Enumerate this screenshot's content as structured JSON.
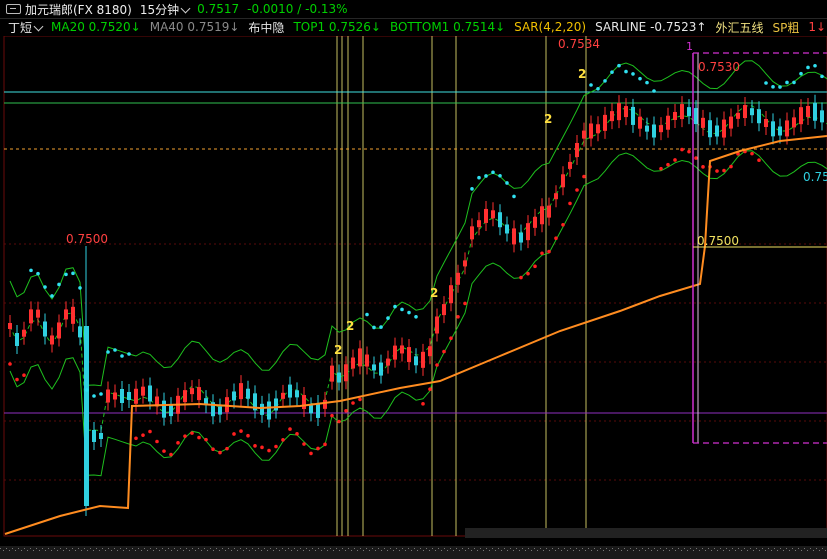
{
  "window": {
    "title": "加元瑞郎(FX 8180)",
    "period": "15分钟",
    "price": "0.7517",
    "change": "-0.0010 / -0.13%"
  },
  "indicators": {
    "style": "丁短",
    "ma20": "MA20 0.7520↓",
    "ma40": "MA40 0.7519↓",
    "layout": "布中隐",
    "top1": "TOP1 0.7526↓",
    "bottom1": "BOTTOM1 0.7514↓",
    "sar": "SAR(4,2,20)",
    "sarline": "SARLINE -0.7523↑",
    "fx_lines": "外汇五线",
    "sp": "SP粗",
    "sp_count": "1↓"
  },
  "chart": {
    "labels": {
      "high_left": "0.7500",
      "high_top": "0.7534",
      "box_top": "0.7530",
      "box_mid": "0.7500",
      "box_index": "1",
      "right_edge": "0.75",
      "marks": [
        "2",
        "2",
        "2",
        "2",
        "2"
      ]
    },
    "colors": {
      "up": "#ff3030",
      "down": "#30d0e0",
      "sar": "#ff2020",
      "sar_top": "#30e0f0",
      "ma": "#ff8c20",
      "boll": "#1ec01e",
      "vline": "#e8e070",
      "box": "#d030d0",
      "cyan_h": "#40e0e0",
      "orange_h": "#f0a030",
      "purple_h": "#9030c0"
    }
  }
}
